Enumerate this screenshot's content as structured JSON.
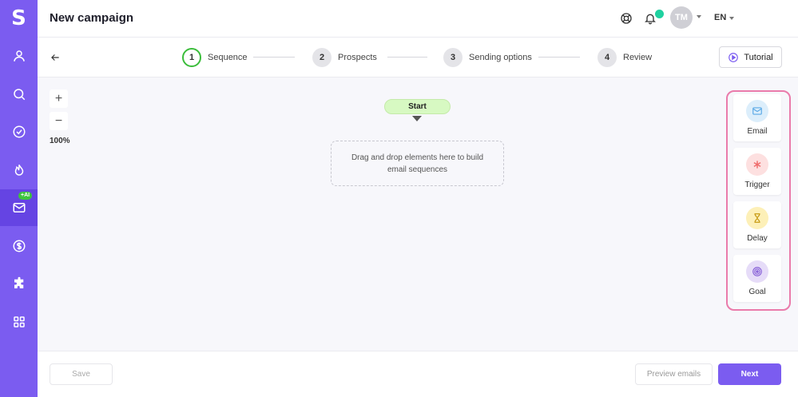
{
  "app": {
    "logo_letter": "S"
  },
  "sidebar": {
    "items": [
      {
        "icon": "user-icon"
      },
      {
        "icon": "search-icon"
      },
      {
        "icon": "check-circle-icon"
      },
      {
        "icon": "flame-icon"
      },
      {
        "icon": "mail-icon",
        "badge": "+AI",
        "active": true
      },
      {
        "icon": "dollar-icon"
      },
      {
        "icon": "puzzle-icon"
      },
      {
        "icon": "grid-icon"
      }
    ]
  },
  "header": {
    "title": "New campaign",
    "avatar_initials": "TM",
    "language": "EN"
  },
  "steps": [
    {
      "number": "1",
      "label": "Sequence",
      "active": true
    },
    {
      "number": "2",
      "label": "Prospects"
    },
    {
      "number": "3",
      "label": "Sending options"
    },
    {
      "number": "4",
      "label": "Review"
    }
  ],
  "tutorial_label": "Tutorial",
  "canvas": {
    "zoom_in": "+",
    "zoom_out": "−",
    "zoom_level": "100%",
    "start_label": "Start",
    "drop_hint": "Drag and drop elements here to build email sequences"
  },
  "palette": [
    {
      "label": "Email",
      "icon": "mail-icon",
      "color": "#5aa9e6",
      "bg": "#dceefb"
    },
    {
      "label": "Trigger",
      "icon": "asterisk-icon",
      "color": "#ef6b6b",
      "bg": "#fde0e0"
    },
    {
      "label": "Delay",
      "icon": "hourglass-icon",
      "color": "#c79a12",
      "bg": "#fdf0b8"
    },
    {
      "label": "Goal",
      "icon": "target-icon",
      "color": "#8a64d8",
      "bg": "#e6dcf8"
    }
  ],
  "footer": {
    "save_label": "Save",
    "preview_label": "Preview emails",
    "next_label": "Next"
  },
  "colors": {
    "brand": "#7b5cf0",
    "active_step": "#3bbd3b",
    "palette_highlight": "#ea7bab"
  }
}
